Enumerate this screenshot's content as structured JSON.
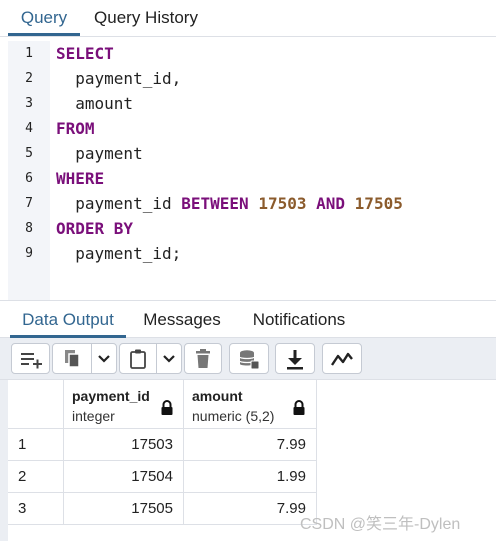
{
  "top_tabs": [
    {
      "label": "Query",
      "active": true
    },
    {
      "label": "Query History",
      "active": false
    }
  ],
  "editor": {
    "line_numbers": [
      "1",
      "2",
      "3",
      "4",
      "5",
      "6",
      "7",
      "8",
      "9"
    ],
    "lines": [
      {
        "kw": "SELECT"
      },
      {
        "text": "  payment_id,"
      },
      {
        "text": "  amount"
      },
      {
        "kw": "FROM"
      },
      {
        "text": "  payment"
      },
      {
        "kw": "WHERE"
      },
      {
        "text": "  payment_id ",
        "kw2": "BETWEEN",
        "n1": "17503",
        "kw3": "AND",
        "n2": "17505"
      },
      {
        "kw": "ORDER BY"
      },
      {
        "text": "  payment_id;"
      }
    ]
  },
  "output_tabs": [
    {
      "label": "Data Output",
      "active": true
    },
    {
      "label": "Messages",
      "active": false
    },
    {
      "label": "Notifications",
      "active": false
    }
  ],
  "toolbar": {
    "icons": [
      "add-row-icon",
      "copy-icon",
      "chevron-down-icon",
      "paste-icon",
      "chevron-down-icon",
      "delete-icon",
      "save-data-icon",
      "download-icon",
      "graph-icon"
    ]
  },
  "grid": {
    "columns": [
      {
        "name": "payment_id",
        "type": "integer"
      },
      {
        "name": "amount",
        "type": "numeric (5,2)"
      }
    ],
    "rows": [
      {
        "num": "1",
        "payment_id": "17503",
        "amount": "7.99"
      },
      {
        "num": "2",
        "payment_id": "17504",
        "amount": "1.99"
      },
      {
        "num": "3",
        "payment_id": "17505",
        "amount": "7.99"
      }
    ]
  },
  "watermark": "CSDN @笑三年-Dylen",
  "colors": {
    "accent": "#326690",
    "keyword": "#7a0f7a",
    "number": "#8b5b2c",
    "gutter": "#f3f5f9",
    "toolbar_bg": "#ebeef3"
  }
}
